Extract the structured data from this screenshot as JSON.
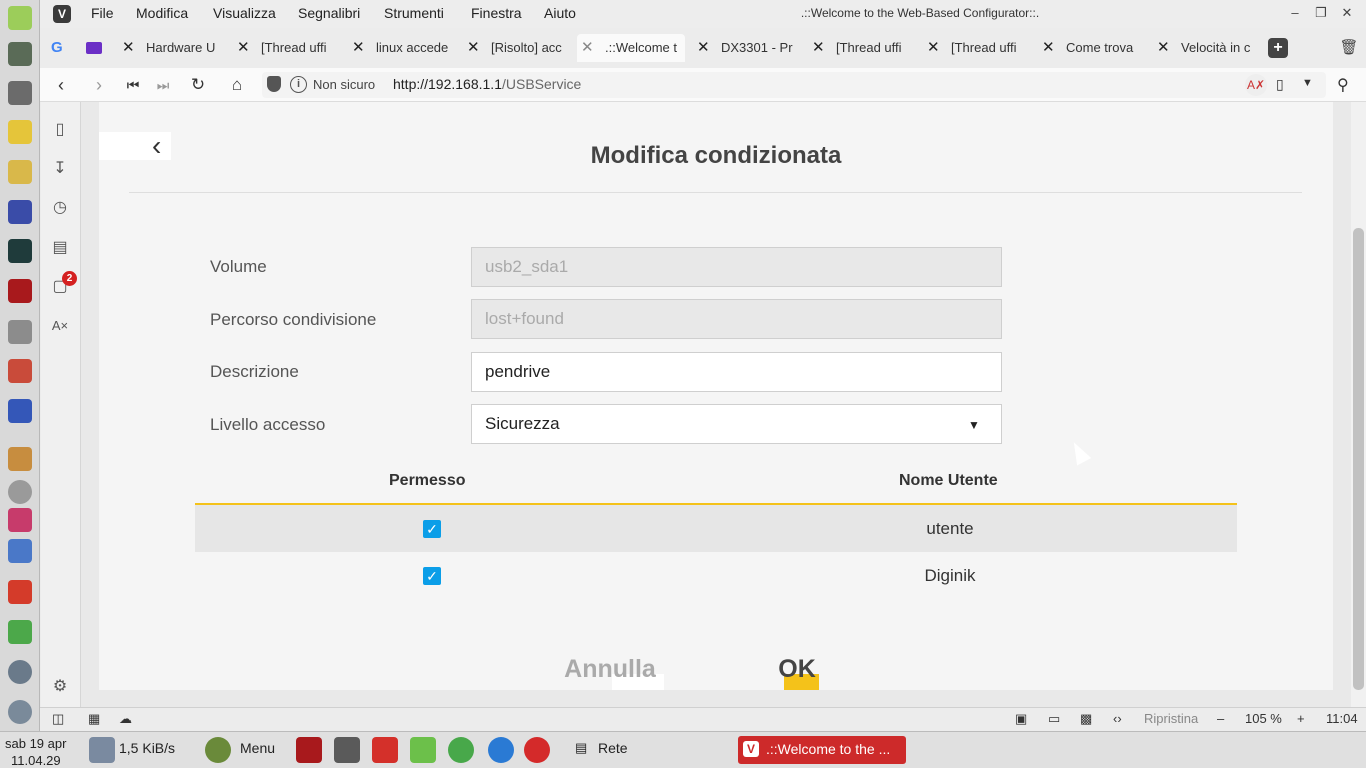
{
  "window": {
    "title": ".::Welcome to the Web-Based Configurator::.",
    "logo": "V",
    "menu": [
      "File",
      "Modifica",
      "Visualizza",
      "Segnalibri",
      "Strumenti",
      "Finestra",
      "Aiuto"
    ],
    "controls": [
      "minimize-icon",
      "restore-icon",
      "close-icon"
    ]
  },
  "tabs": [
    {
      "icon": "google-icon",
      "title": ""
    },
    {
      "icon": "mail-icon",
      "title": ""
    },
    {
      "title": "Hardware U"
    },
    {
      "title": "[Thread uffi"
    },
    {
      "title": "linux accede"
    },
    {
      "title": "[Risolto] acc"
    },
    {
      "title": ".::Welcome t",
      "active": true
    },
    {
      "title": "DX3301 - Pr"
    },
    {
      "title": "[Thread uffi"
    },
    {
      "title": "[Thread uffi"
    },
    {
      "title": "Come trova"
    },
    {
      "title": "Velocità in c"
    }
  ],
  "addressbar": {
    "security": "Non sicuro",
    "url_host": "http://192.168.1.1",
    "url_path": "/USBService"
  },
  "panel": {
    "badge": "2"
  },
  "page": {
    "heading": "Modifica condizionata",
    "fields": {
      "volume_label": "Volume",
      "volume_value": "usb2_sda1",
      "path_label": "Percorso condivisione",
      "path_value": "lost+found",
      "desc_label": "Descrizione",
      "desc_value": "pendrive",
      "access_label": "Livello accesso",
      "access_value": "Sicurezza"
    },
    "table": {
      "col_permission": "Permesso",
      "col_user": "Nome Utente",
      "rows": [
        {
          "checked": true,
          "user": "utente"
        },
        {
          "checked": true,
          "user": "Diginik"
        }
      ]
    },
    "cancel_label": "Annulla",
    "ok_label": "OK"
  },
  "statusbar": {
    "reset_label": "Ripristina",
    "zoom": "105 %",
    "clock": "11:04"
  },
  "taskbar": {
    "date": "sab 19 apr",
    "time": "11.04.29",
    "netspeed": "1,5 KiB/s",
    "menu_label": "Menu",
    "network_label": "Rete",
    "active_window": ".::Welcome to the ..."
  }
}
